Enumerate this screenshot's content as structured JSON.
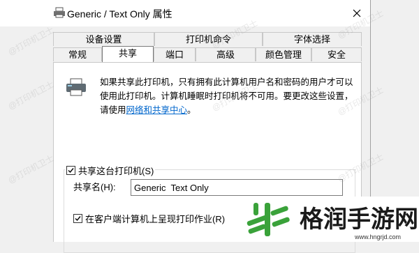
{
  "window": {
    "title": "Generic / Text Only 属性"
  },
  "tabs": {
    "row1": [
      "设备设置",
      "打印机命令",
      "字体选择"
    ],
    "row2": [
      "常规",
      "共享",
      "端口",
      "高级",
      "颜色管理",
      "安全"
    ],
    "active": "共享"
  },
  "info": {
    "text": "如果共享此打印机，只有拥有此计算机用户名和密码的用户才可以使用此打印机。计算机睡眠时打印机将不可用。要更改这些设置，请使用",
    "link": "网络和共享中心",
    "suffix": "。"
  },
  "share": {
    "checkbox_label": "共享这台打印机(S)",
    "checked": true,
    "name_label": "共享名(H):",
    "name_value": "Generic  Text Only",
    "render_label": "在客户端计算机上呈现打印作业(R)",
    "render_checked": true
  },
  "watermark": "@打印机卫士",
  "site": {
    "name": "格润手游网",
    "url": "www.hngrjd.com"
  },
  "colors": {
    "link": "#0066cc",
    "logo_green": "#3aa23a"
  }
}
